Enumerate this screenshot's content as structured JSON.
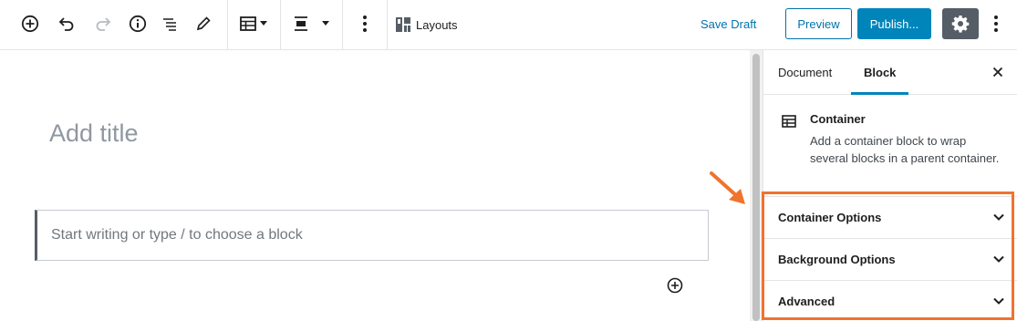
{
  "toolbar": {
    "layouts_label": "Layouts",
    "save_draft_label": "Save Draft",
    "preview_label": "Preview",
    "publish_label": "Publish..."
  },
  "editor": {
    "title_placeholder": "Add title",
    "block_placeholder": "Start writing or type / to choose a block"
  },
  "sidebar": {
    "tabs": [
      {
        "label": "Document",
        "active": false
      },
      {
        "label": "Block",
        "active": true
      }
    ],
    "block_card": {
      "title": "Container",
      "description": "Add a container block to wrap several blocks in a parent container."
    },
    "panels": [
      {
        "label": "Container Options"
      },
      {
        "label": "Background Options"
      },
      {
        "label": "Advanced"
      }
    ]
  },
  "colors": {
    "accent": "#0085ba",
    "link": "#0073aa",
    "highlight": "#f0732e",
    "settings_bg": "#555d66"
  },
  "icons": [
    "add-block-icon",
    "undo-icon",
    "redo-icon",
    "info-icon",
    "outline-icon",
    "edit-icon",
    "table-icon",
    "align-center-icon",
    "more-vertical-icon",
    "layouts-grid-icon",
    "gear-icon",
    "close-icon",
    "chevron-down-icon",
    "plus-circle-icon"
  ]
}
